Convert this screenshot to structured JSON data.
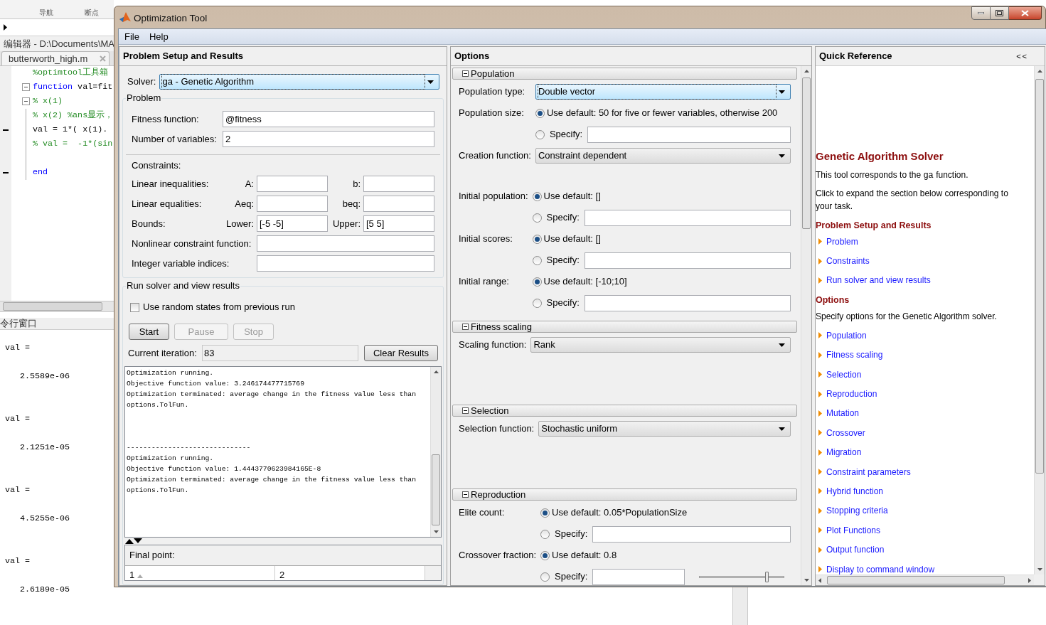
{
  "background_app": {
    "toolbar_labels": [
      "导航",
      "断点"
    ],
    "editor": {
      "title": "编辑器 - D:\\Documents\\MA",
      "tab": "butterworth_high.m",
      "lines": [
        {
          "foldable": false,
          "executable": false,
          "segments": [
            {
              "kind": "comment",
              "text": "%optimtool工具箱"
            }
          ]
        },
        {
          "foldable": true,
          "executable": false,
          "segments": [
            {
              "kind": "keyword",
              "text": "function"
            },
            {
              "kind": "plain",
              "text": " val=fit"
            }
          ]
        },
        {
          "foldable": true,
          "executable": false,
          "segments": [
            {
              "kind": "comment",
              "text": "% x(1)"
            }
          ]
        },
        {
          "foldable": false,
          "executable": false,
          "segments": [
            {
              "kind": "comment",
              "text": "% x(2) %ans显示，"
            }
          ]
        },
        {
          "foldable": false,
          "executable": true,
          "segments": [
            {
              "kind": "plain",
              "text": "val = 1*( x(1)."
            }
          ]
        },
        {
          "foldable": false,
          "executable": false,
          "segments": [
            {
              "kind": "comment",
              "text": "% val =  -1*(sin"
            }
          ]
        },
        {
          "foldable": false,
          "executable": false
        },
        {
          "foldable": false,
          "executable": true,
          "segments": [
            {
              "kind": "keyword",
              "text": "end"
            }
          ]
        }
      ]
    },
    "command_window": {
      "title": "令行窗口",
      "outputs": [
        {
          "name": "val =",
          "value": "2.5589e-06"
        },
        {
          "name": "val =",
          "value": "2.1251e-05"
        },
        {
          "name": "val =",
          "value": "4.5255e-06"
        },
        {
          "name": "val =",
          "value": "2.6189e-05"
        }
      ]
    }
  },
  "window": {
    "title": "Optimization Tool",
    "menu": [
      "File",
      "Help"
    ]
  },
  "problem_setup": {
    "title": "Problem Setup and Results",
    "solver": {
      "label": "Solver:",
      "value": "ga - Genetic Algorithm",
      "highlighted": true
    },
    "problem": {
      "title": "Problem",
      "fields": [
        {
          "label": "Fitness function:",
          "value": "@fitness"
        },
        {
          "label": "Number of variables:",
          "value": "2"
        }
      ],
      "constraints_label": "Constraints:",
      "constraints": [
        {
          "kind": "pair",
          "label": "Linear inequalities:",
          "fields": [
            {
              "label": "A:"
            },
            {
              "label": "b:"
            }
          ]
        },
        {
          "kind": "pair",
          "label": "Linear equalities:",
          "fields": [
            {
              "label": "Aeq:"
            },
            {
              "label": "beq:"
            }
          ]
        },
        {
          "kind": "pair",
          "label": "Bounds:",
          "fields": [
            {
              "label": "Lower:",
              "value": "[-5 -5]"
            },
            {
              "label": "Upper:",
              "value": "[5 5]"
            }
          ]
        },
        {
          "kind": "single",
          "label": "Nonlinear constraint function:"
        },
        {
          "kind": "single",
          "label": "Integer variable indices:"
        }
      ]
    },
    "run": {
      "title": "Run solver and view results",
      "random_states": {
        "label": "Use random states from previous run",
        "checked": false
      },
      "buttons": [
        {
          "label": "Start",
          "disabled": false
        },
        {
          "label": "Pause",
          "disabled": true
        },
        {
          "label": "Stop",
          "disabled": true
        }
      ],
      "iteration": {
        "label": "Current iteration:",
        "value": "83"
      },
      "clear_button": "Clear Results",
      "output": [
        {
          "kind": "run",
          "lines": [
            "Optimization running.",
            "Objective function value: 3.246174477715769",
            "Optimization terminated: average change in the fitness value less than",
            "options.TolFun."
          ]
        },
        {
          "kind": "separator",
          "lines": [
            "------------------------------"
          ]
        },
        {
          "kind": "run",
          "lines": [
            "Optimization running.",
            "Objective function value: 1.4443770623984165E-8",
            "Optimization terminated: average change in the fitness value less than",
            "options.TolFun."
          ]
        }
      ],
      "final_point": {
        "label": "Final point:",
        "columns": [
          "1",
          "2"
        ]
      }
    }
  },
  "options": {
    "title": "Options",
    "sections": [
      {
        "title": "Population",
        "expanded": true,
        "groups": [
          [
            {
              "kind": "dropdown",
              "label": "Population type:",
              "value": "Double vector",
              "highlighted": true
            },
            {
              "kind": "choice",
              "label": "Population size:",
              "options": [
                {
                  "kind": "default",
                  "text": "Use default: 50 for five or fewer variables, otherwise 200",
                  "selected": true
                },
                {
                  "kind": "specify",
                  "text": "Specify:",
                  "selected": false
                }
              ]
            },
            {
              "kind": "dropdown",
              "label": "Creation function:",
              "value": "Constraint dependent",
              "highlighted": false
            }
          ],
          [
            {
              "kind": "choice",
              "label": "Initial population:",
              "options": [
                {
                  "kind": "default",
                  "text": "Use default: []",
                  "selected": true
                },
                {
                  "kind": "specify",
                  "text": "Specify:",
                  "selected": false
                }
              ]
            },
            {
              "kind": "choice",
              "label": "Initial scores:",
              "options": [
                {
                  "kind": "default",
                  "text": "Use default: []",
                  "selected": true
                },
                {
                  "kind": "specify",
                  "text": "Specify:",
                  "selected": false
                }
              ]
            },
            {
              "kind": "choice",
              "label": "Initial range:",
              "options": [
                {
                  "kind": "default",
                  "text": "Use default: [-10;10]",
                  "selected": true
                },
                {
                  "kind": "specify",
                  "text": "Specify:",
                  "selected": false
                }
              ]
            }
          ]
        ]
      },
      {
        "title": "Fitness scaling",
        "expanded": true,
        "groups": [
          [
            {
              "kind": "dropdown",
              "label": "Scaling function:",
              "value": "Rank",
              "highlighted": false
            }
          ]
        ]
      },
      {
        "title": "Selection",
        "expanded": true,
        "groups": [
          [
            {
              "kind": "dropdown",
              "label": "Selection function:",
              "value": "Stochastic uniform",
              "highlighted": false
            }
          ]
        ]
      },
      {
        "title": "Reproduction",
        "expanded": true,
        "groups": [
          [
            {
              "kind": "choice",
              "label": "Elite count:",
              "options": [
                {
                  "kind": "default",
                  "text": "Use default: 0.05*PopulationSize",
                  "selected": true
                },
                {
                  "kind": "specify",
                  "text": "Specify:",
                  "selected": false
                }
              ]
            },
            {
              "kind": "choice",
              "label": "Crossover fraction:",
              "options": [
                {
                  "kind": "default",
                  "text": "Use default: 0.8",
                  "selected": true
                },
                {
                  "kind": "specify",
                  "text": "Specify:",
                  "selected": false,
                  "slider": {
                    "level": 0.8
                  }
                }
              ]
            }
          ]
        ]
      }
    ]
  },
  "quick_reference": {
    "title": "Quick Reference",
    "collapse": "<<",
    "heading": "Genetic Algorithm Solver",
    "intro": {
      "before": "This tool corresponds to the ",
      "code": "ga",
      "after": " function."
    },
    "instruction": "Click to expand the section below corresponding to your task.",
    "sections": [
      {
        "heading": "Problem Setup and Results",
        "links": [
          "Problem",
          "Constraints",
          "Run solver and view results"
        ]
      },
      {
        "heading": "Options",
        "description": "Specify options for the Genetic Algorithm solver.",
        "links": [
          "Population",
          "Fitness scaling",
          "Selection",
          "Reproduction",
          "Mutation",
          "Crossover",
          "Migration",
          "Constraint parameters",
          "Hybrid function",
          "Stopping criteria",
          "Plot Functions",
          "Output function",
          "Display to command window"
        ]
      }
    ]
  }
}
